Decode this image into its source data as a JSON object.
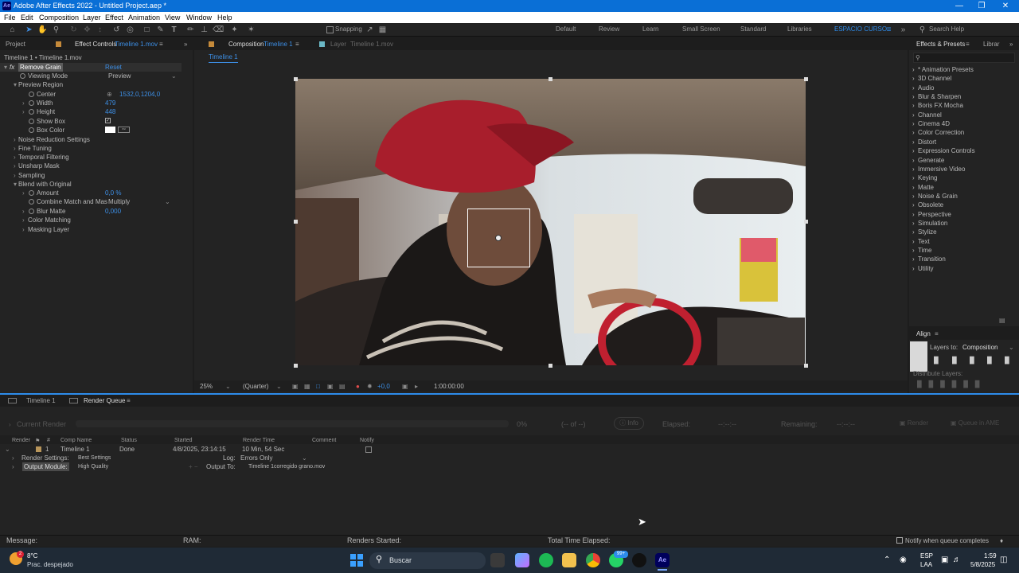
{
  "window": {
    "title": "Adobe After Effects 2022 - Untitled Project.aep *",
    "logo": "Ae"
  },
  "menu": [
    "File",
    "Edit",
    "Composition",
    "Layer",
    "Effect",
    "Animation",
    "View",
    "Window",
    "Help"
  ],
  "toolbar": {
    "snapping_label": "Snapping",
    "workspaces": [
      "Default",
      "Review",
      "Learn",
      "Small Screen",
      "Standard",
      "Libraries",
      "ESPACIO CURSO"
    ],
    "search_placeholder": "Search Help"
  },
  "left_panel": {
    "tab_project": "Project",
    "tab_effect_controls": "Effect Controls",
    "tab_effect_controls_layer": "Timeline 1.mov",
    "layer_path": "Timeline 1 • Timeline 1.mov",
    "effect_name": "Remove Grain",
    "reset": "Reset",
    "props": {
      "viewing_mode": "Viewing Mode",
      "viewing_mode_value": "Preview",
      "preview_region": "Preview Region",
      "center": "Center",
      "center_value": "1532,0,1204,0",
      "width": "Width",
      "width_value": "479",
      "height": "Height",
      "height_value": "448",
      "show_box": "Show Box",
      "box_color": "Box Color",
      "noise_reduction": "Noise Reduction Settings",
      "fine_tuning": "Fine Tuning",
      "temporal_filtering": "Temporal Filtering",
      "unsharp_mask": "Unsharp Mask",
      "sampling": "Sampling",
      "blend_with_original": "Blend with Original",
      "amount": "Amount",
      "amount_value": "0,0 %",
      "combine_match": "Combine Match and Mas",
      "combine_match_value": "Multiply",
      "blur_matte": "Blur Matte",
      "blur_matte_value": "0,000",
      "color_matching": "Color Matching",
      "masking_layer": "Masking Layer"
    }
  },
  "comp_panel": {
    "tab_composition": "Composition",
    "tab_composition_name": "Timeline 1",
    "tab_layer": "Layer",
    "tab_layer_name": "Timeline 1.mov",
    "sub_tab": "Timeline 1",
    "zoom": "25%",
    "resolution": "(Quarter)",
    "exposure": "+0,0",
    "timecode": "1:00:00:00"
  },
  "effects_presets": {
    "tab": "Effects & Presets",
    "tab_libraries": "Librar",
    "items": [
      "* Animation Presets",
      "3D Channel",
      "Audio",
      "Blur & Sharpen",
      "Boris FX Mocha",
      "Channel",
      "Cinema 4D",
      "Color Correction",
      "Distort",
      "Expression Controls",
      "Generate",
      "Immersive Video",
      "Keying",
      "Matte",
      "Noise & Grain",
      "Obsolete",
      "Perspective",
      "Simulation",
      "Stylize",
      "Text",
      "Time",
      "Transition",
      "Utility"
    ]
  },
  "align": {
    "tab": "Align",
    "align_layers_to": "Layers to:",
    "align_target": "Composition",
    "distribute_layers": "Distribute Layers:"
  },
  "render_queue": {
    "tab_timeline": "Timeline 1",
    "tab_render_queue": "Render Queue",
    "current_render": "Current Render",
    "percent": "0%",
    "of_count": "(-- of --)",
    "info": "Info",
    "elapsed": "Elapsed:",
    "elapsed_value": "--:--:--",
    "remaining": "Remaining:",
    "remaining_value": "--:--:--",
    "render_button": "Render",
    "queue_ame": "Queue in AME",
    "columns": [
      "Render",
      "#",
      "Comp Name",
      "Status",
      "Started",
      "Render Time",
      "Comment",
      "Notify"
    ],
    "item": {
      "index": "1",
      "comp_name": "Timeline 1",
      "status": "Done",
      "started": "4/8/2025, 23:14:15",
      "render_time": "10 Min, 54 Sec"
    },
    "render_settings_label": "Render Settings:",
    "render_settings_value": "Best Settings",
    "log_label": "Log:",
    "log_value": "Errors Only",
    "output_module_label": "Output Module:",
    "output_module_value": "High Quality",
    "output_to_label": "Output To:",
    "output_to_value": "Timeline 1corregido grano.mov"
  },
  "status_bar": {
    "message": "Message:",
    "ram": "RAM:",
    "renders_started": "Renders Started:",
    "total_time": "Total Time Elapsed:",
    "notify": "Notify when queue completes"
  },
  "taskbar": {
    "weather_temp": "8°C",
    "weather_desc": "Prac. despejado",
    "weather_badge": "2",
    "search": "Buscar",
    "whatsapp_badge": "99+",
    "lang1": "ESP",
    "lang2": "LAA",
    "time": "1:59",
    "date": "5/8/2025"
  },
  "colors": {
    "accent": "#2d8ceb",
    "titlebar": "#0a6fd6",
    "panel": "#232323"
  }
}
